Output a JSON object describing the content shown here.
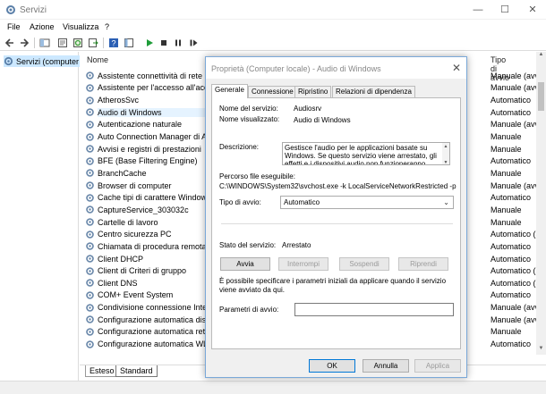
{
  "window": {
    "title": "Servizi"
  },
  "window_controls": {
    "minimize": "—",
    "maximize": "☐",
    "close": "✕"
  },
  "menu": [
    "File",
    "Azione",
    "Visualizza",
    "?"
  ],
  "tree": {
    "root": "Servizi (computer locale)"
  },
  "list": {
    "header_name": "Nome",
    "header_startup": "Tipo di avvio",
    "rows": [
      {
        "name": "Assistente connettività di rete",
        "startup": "Manuale (avvio"
      },
      {
        "name": "Assistente per l'accesso all'account",
        "startup": "Manuale (avvio"
      },
      {
        "name": "AtherosSvc",
        "startup": "Automatico"
      },
      {
        "name": "Audio di Windows",
        "startup": "Automatico"
      },
      {
        "name": "Autenticazione naturale",
        "startup": "Manuale (avvio"
      },
      {
        "name": "Auto Connection Manager di Accesso",
        "startup": "Manuale"
      },
      {
        "name": "Avvisi e registri di prestazioni",
        "startup": "Manuale"
      },
      {
        "name": "BFE (Base Filtering Engine)",
        "startup": "Automatico"
      },
      {
        "name": "BranchCache",
        "startup": "Manuale"
      },
      {
        "name": "Browser di computer",
        "startup": "Manuale (avvio"
      },
      {
        "name": "Cache tipi di carattere Windows",
        "startup": "Automatico"
      },
      {
        "name": "CaptureService_303032c",
        "startup": "Manuale"
      },
      {
        "name": "Cartelle di lavoro",
        "startup": "Manuale"
      },
      {
        "name": "Centro sicurezza PC",
        "startup": "Automatico (av"
      },
      {
        "name": "Chiamata di procedura remota (RPC)",
        "startup": "Automatico"
      },
      {
        "name": "Client DHCP",
        "startup": "Automatico"
      },
      {
        "name": "Client di Criteri di gruppo",
        "startup": "Automatico (av"
      },
      {
        "name": "Client DNS",
        "startup": "Automatico (av"
      },
      {
        "name": "COM+ Event System",
        "startup": "Automatico"
      },
      {
        "name": "Condivisione connessione Internet",
        "startup": "Manuale (avvio"
      },
      {
        "name": "Configurazione automatica dispositivi",
        "startup": "Manuale (avvio"
      },
      {
        "name": "Configurazione automatica reti cablate",
        "startup": "Manuale"
      },
      {
        "name": "Configurazione automatica WLAN",
        "startup": "Automatico"
      }
    ]
  },
  "bottom_tabs": [
    "Esteso",
    "Standard"
  ],
  "dialog": {
    "title": "Proprietà (Computer locale) - Audio di Windows",
    "tabs": [
      "Generale",
      "Connessione",
      "Ripristino",
      "Relazioni di dipendenza"
    ],
    "service_name_label": "Nome del servizio:",
    "service_name": "Audiosrv",
    "display_name_label": "Nome visualizzato:",
    "display_name": "Audio di Windows",
    "description_label": "Descrizione:",
    "description": "Gestisce l'audio per le applicazioni basate su Windows. Se questo servizio viene arrestato, gli effetti e i dispositivi audio non funzioneranno",
    "path_label": "Percorso file eseguibile:",
    "path": "C:\\WINDOWS\\System32\\svchost.exe -k LocalServiceNetworkRestricted -p",
    "startup_label": "Tipo di avvio:",
    "startup_value": "Automatico",
    "status_label": "Stato del servizio:",
    "status_value": "Arrestato",
    "btn_start": "Avvia",
    "btn_stop": "Interrompi",
    "btn_pause": "Sospendi",
    "btn_resume": "Riprendi",
    "hint": "È possibile specificare i parametri iniziali da applicare quando il servizio viene avviato da qui.",
    "params_label": "Parametri di avvio:",
    "btn_ok": "OK",
    "btn_cancel": "Annulla",
    "btn_apply": "Applica"
  }
}
